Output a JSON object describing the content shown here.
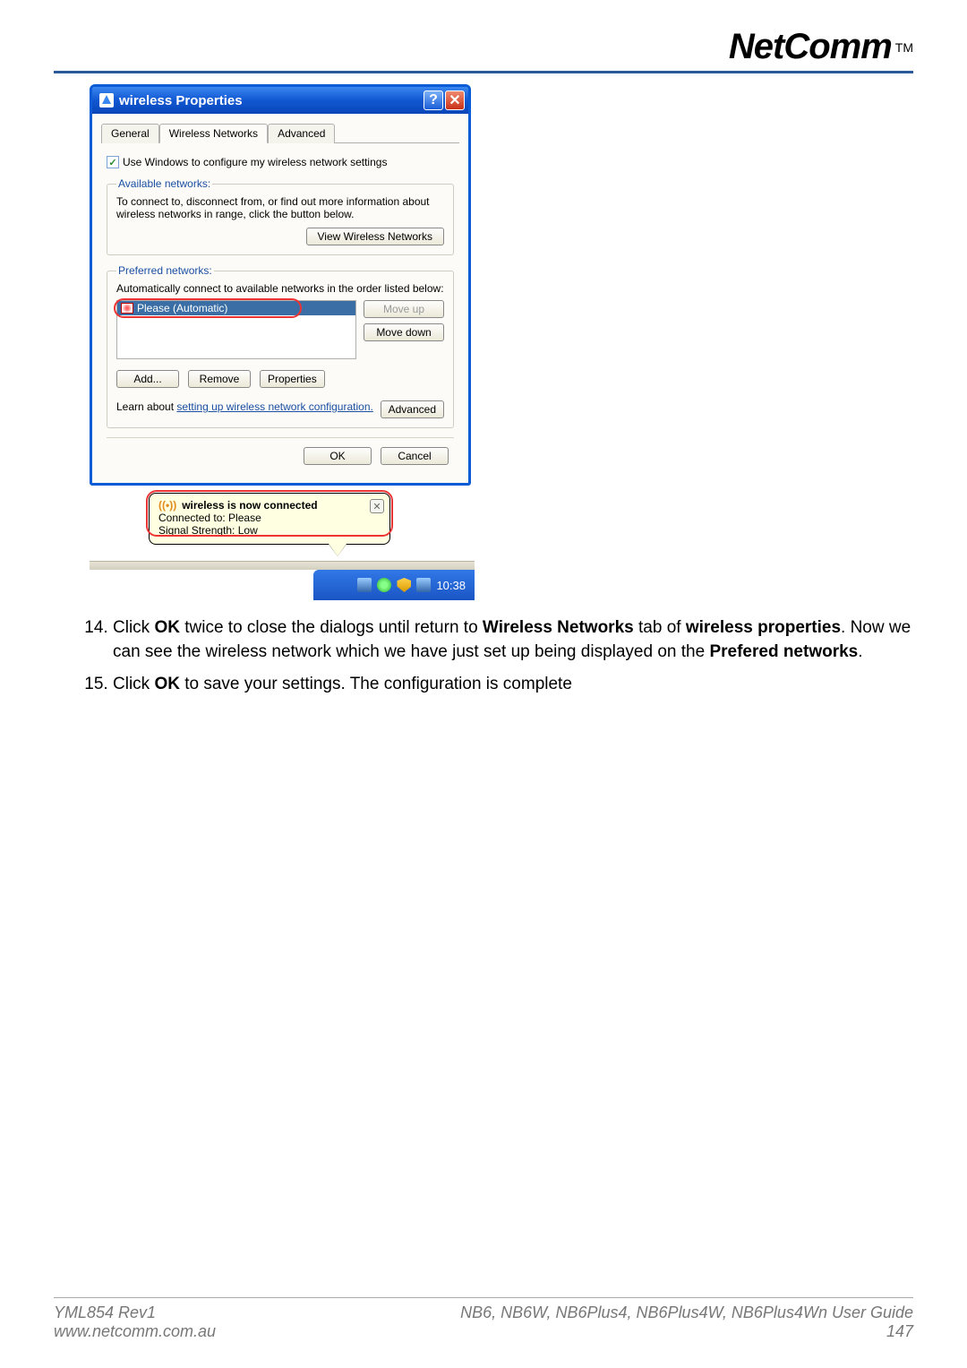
{
  "brand": "NetComm",
  "tm": "TM",
  "dialog": {
    "title": "wireless Properties",
    "tabs": {
      "general": "General",
      "wireless": "Wireless Networks",
      "advanced": "Advanced"
    },
    "use_windows_label": "Use Windows to configure my wireless network settings",
    "available": {
      "legend": "Available networks:",
      "text": "To connect to, disconnect from, or find out more information about wireless networks in range, click the button below.",
      "view_btn": "View Wireless Networks"
    },
    "preferred": {
      "legend": "Preferred networks:",
      "text": "Automatically connect to available networks in the order listed below:",
      "item": "Please (Automatic)",
      "move_up": "Move up",
      "move_down": "Move down",
      "add": "Add...",
      "remove": "Remove",
      "properties": "Properties"
    },
    "learn_prefix": "Learn about ",
    "learn_link": "setting up wireless network configuration.",
    "advanced_btn": "Advanced",
    "ok": "OK",
    "cancel": "Cancel"
  },
  "balloon": {
    "title": "wireless is now connected",
    "line1": "Connected to: Please",
    "line2": "Signal Strength: Low"
  },
  "tray": {
    "time": "10:38"
  },
  "steps": {
    "s14_prefix": "Click ",
    "s14_ok": "OK",
    "s14_mid1": " twice to close the dialogs until return to ",
    "s14_wn": "Wireless Networks",
    "s14_mid2": " tab of ",
    "s14_wp": "wireless properties",
    "s14_mid3": ". Now we can see the wireless network which we have just set up being displayed on the ",
    "s14_pn": "Prefered networks",
    "s14_end": ".",
    "s15_prefix": "Click ",
    "s15_ok": "OK",
    "s15_rest": " to save your settings. The configuration is complete"
  },
  "footer": {
    "rev": "YML854 Rev1",
    "url": "www.netcomm.com.au",
    "models": "NB6, NB6W, NB6Plus4, NB6Plus4W, NB6Plus4Wn User Guide",
    "page": "147"
  }
}
